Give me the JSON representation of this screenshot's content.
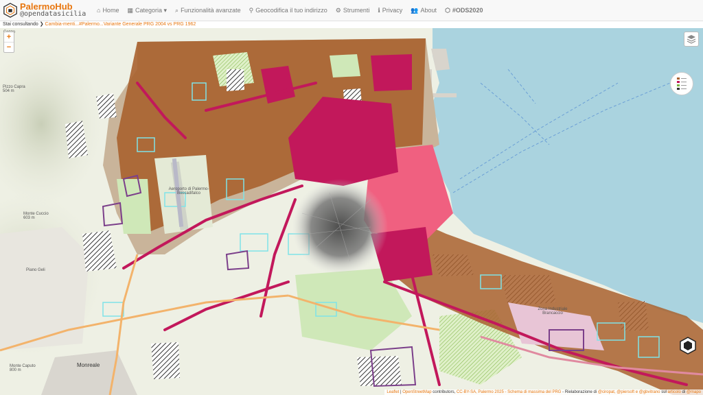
{
  "brand": {
    "name": "PalermoHub",
    "sub": "@opendatasicilia"
  },
  "nav": [
    {
      "icon": "home-icon",
      "glyph": "⌂",
      "label": "Home"
    },
    {
      "icon": "grid-icon",
      "glyph": "▦",
      "label": "Categoria ▾"
    },
    {
      "icon": "search-icon",
      "glyph": "⌕",
      "label": "Funzionalità avanzate"
    },
    {
      "icon": "map-marker-icon",
      "glyph": "⚲",
      "label": "Geocodifica il tuo indirizzo"
    },
    {
      "icon": "gear-icon",
      "glyph": "⚙",
      "label": "Strumenti"
    },
    {
      "icon": "info-icon",
      "glyph": "ℹ",
      "label": "Privacy"
    },
    {
      "icon": "users-icon",
      "glyph": "👥",
      "label": "About"
    },
    {
      "icon": "ods-icon",
      "glyph": "⬡",
      "label": "#ODS2020"
    }
  ],
  "breadcrumb": {
    "prefix": "Stai consultando",
    "link": "Cambia-menti...#Palermo...Variante Generale PRG 2004 vs PRG 1962"
  },
  "map": {
    "zoom_in": "+",
    "zoom_out": "−",
    "labels": {
      "pizzo_capra": "Pizzo Capra",
      "pizzo_capra_alt": "504 m",
      "monte_cuccio": "Monte Cuccio",
      "monte_cuccio_alt": "603 m",
      "aeroporto": "Aeroporto di Palermo-Boccadifalco",
      "piano_geli": "Piano Geli",
      "monreale": "Monreale",
      "monte_caputo": "Monte Caputo",
      "monte_caputo_alt": "800 m",
      "zona_industriale": "Zona Industriale Brancaccio",
      "cozzo": "Cozzo"
    },
    "colors": {
      "sea": "#aad3df",
      "land": "#f2efe9",
      "brown": "#a9622f",
      "crimson": "#c2185b",
      "pink": "#f06080",
      "green": "#cfe8b8",
      "cyan": "#7fe3e8"
    }
  },
  "attribution": {
    "leaflet": "Leaflet",
    "osm": "OpenStreetMap",
    "contrib": "contributors,",
    "license": "CC-BY-SA,",
    "palermo": "Palermo 2025 - Schema di massima del PRG",
    "elab": "- Rielaborazione di",
    "people": "@ciropat, @piersoft e @gbvitrano",
    "sul": "sul",
    "articolo": "articolo",
    "di": "di",
    "mapo": "@mapo"
  }
}
